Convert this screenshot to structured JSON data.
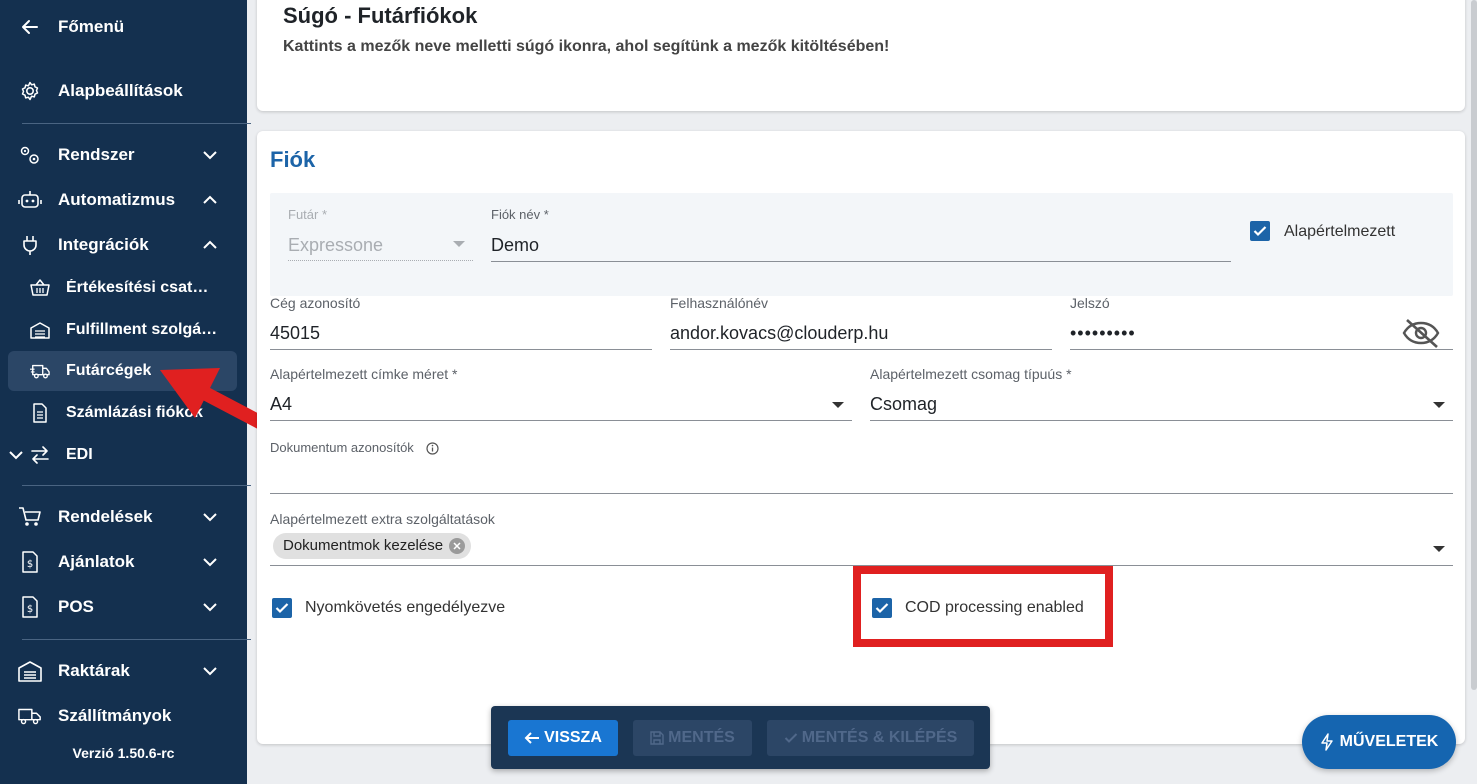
{
  "sidebar": {
    "back": "Főmenü",
    "basic_settings": "Alapbeállítások",
    "system": "Rendszer",
    "automation": "Automatizmus",
    "integrations": "Integrációk",
    "sub": {
      "sales_channels": "Értékesítési csatornák",
      "fulfillment": "Fulfillment szolgáltatók",
      "couriers": "Futárcégek",
      "billing": "Számlázási fiókok",
      "edi": "EDI"
    },
    "orders": "Rendelések",
    "offers": "Ajánlatok",
    "pos": "POS",
    "warehouses": "Raktárak",
    "shipments": "Szállítmányok",
    "version": "Verzió 1.50.6-rc"
  },
  "help": {
    "title": "Súgó - Futárfiókok",
    "text": "Kattints a mezők neve melletti súgó ikonra, ahol segítünk a mezők kitöltésében!"
  },
  "form": {
    "section_title": "Fiók",
    "courier": {
      "label": "Futár *",
      "value": "Expressone"
    },
    "account_name": {
      "label": "Fiók név *",
      "value": "Demo"
    },
    "default_checkbox": {
      "label": "Alapértelmezett",
      "checked": true
    },
    "company_id": {
      "label": "Cég azonosító",
      "value": "45015"
    },
    "username": {
      "label": "Felhasználónév",
      "value": "andor.kovacs@clouderp.hu"
    },
    "password": {
      "label": "Jelszó",
      "value": "•••••••••"
    },
    "label_size": {
      "label": "Alapértelmezett címke méret *",
      "value": "A4"
    },
    "package_type": {
      "label": "Alapértelmezett csomag típuús *",
      "value": "Csomag"
    },
    "document_ids": {
      "label": "Dokumentum azonosítók",
      "value": ""
    },
    "extra_services": {
      "label": "Alapértelmezett extra szolgáltatások",
      "chips": [
        "Dokumentmok kezelése"
      ]
    },
    "tracking": {
      "label": "Nyomkövetés engedélyezve",
      "checked": true
    },
    "cod": {
      "label": "COD processing enabled",
      "checked": true
    }
  },
  "toolbar": {
    "back": "VISSZA",
    "save": "MENTÉS",
    "save_exit": "MENTÉS & KILÉPÉS"
  },
  "fab": {
    "label": "MŰVELETEK"
  },
  "colors": {
    "sidebar_bg": "#14304f",
    "accent": "#1c64a8",
    "highlight": "#e02020"
  }
}
